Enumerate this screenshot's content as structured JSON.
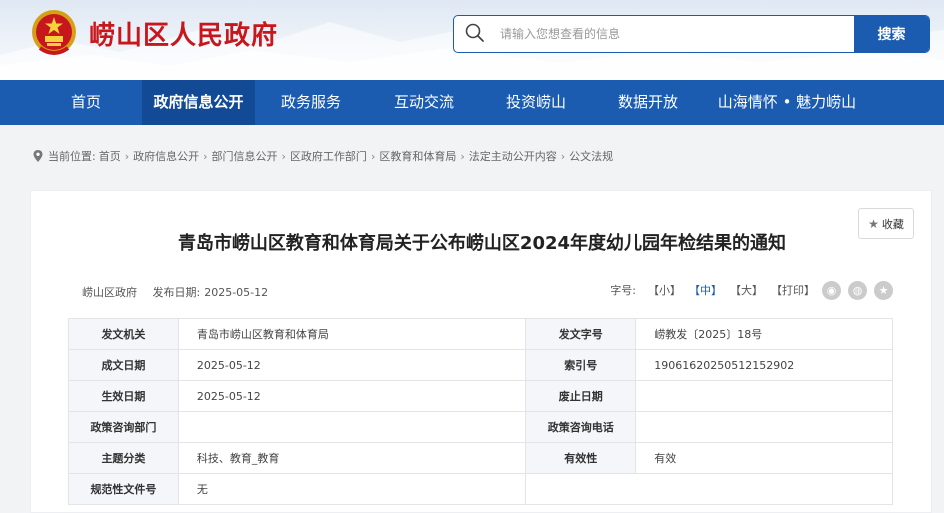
{
  "site": {
    "title": "崂山区人民政府"
  },
  "search": {
    "placeholder": "请输入您想查看的信息",
    "button_label": "搜索"
  },
  "nav": [
    {
      "label": "首页"
    },
    {
      "label": "政府信息公开",
      "active": true
    },
    {
      "label": "政务服务"
    },
    {
      "label": "互动交流"
    },
    {
      "label": "投资崂山"
    },
    {
      "label": "数据开放"
    },
    {
      "label": "山海情怀 • 魅力崂山"
    }
  ],
  "breadcrumb": {
    "prefix": "当前位置:",
    "items": [
      "首页",
      "政府信息公开",
      "部门信息公开",
      "区政府工作部门",
      "区教育和体育局",
      "法定主动公开内容",
      "公文法规"
    ]
  },
  "article": {
    "favorite_label": "收藏",
    "title": "青岛市崂山区教育和体育局关于公布崂山区2024年度幼儿园年检结果的通知",
    "source": "崂山区政府",
    "publish_label": "发布日期:",
    "publish_date": "2025-05-12",
    "font_size_label": "字号:",
    "font_small": "【小】",
    "font_medium": "【中】",
    "font_large": "【大】",
    "print": "【打印】"
  },
  "share_icons": [
    "weibo-share-icon",
    "wechat-share-icon",
    "qzone-share-icon"
  ],
  "info_table": {
    "issuer_label": "发文机关",
    "issuer": "青岛市崂山区教育和体育局",
    "doc_no_label": "发文字号",
    "doc_no": "崂教发〔2025〕18号",
    "created_label": "成文日期",
    "created": "2025-05-12",
    "index_label": "索引号",
    "index_no": "19061620250512152902",
    "effective_label": "生效日期",
    "effective": "2025-05-12",
    "repeal_label": "废止日期",
    "repeal": "",
    "consult_dept_label": "政策咨询部门",
    "consult_dept": "",
    "consult_phone_label": "政策咨询电话",
    "consult_phone": "",
    "category_label": "主题分类",
    "category": "科技、教育_教育",
    "validity_label": "有效性",
    "validity": "有效",
    "normative_label": "规范性文件号",
    "normative": "无"
  },
  "colors": {
    "brand_blue": "#1b5cb0",
    "nav_active": "#124a96",
    "title_red": "#c8161d"
  }
}
